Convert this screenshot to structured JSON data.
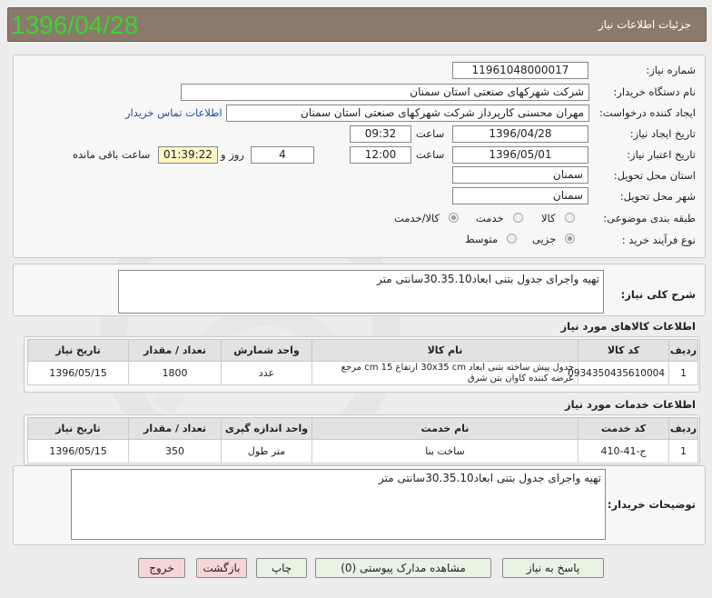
{
  "header": {
    "title": "جزئیات اطلاعات نیاز",
    "big_date": "1396/04/28"
  },
  "form": {
    "need_number_label": "شماره نیاز:",
    "need_number": "11961048000017",
    "buyer_label": "نام دستگاه خریدار:",
    "buyer": "شرکت شهرکهای صنعتی استان سمنان",
    "creator_label": "ایجاد کننده درخواست:",
    "creator": "مهران محسنی کارپرداز شرکت شهرکهای صنعتی استان سمنان",
    "contact_link": "اطلاعات تماس خریدار",
    "created_label": "تاریخ ایجاد نیاز:",
    "created_date": "1396/04/28",
    "time_label": "ساعت",
    "created_time": "09:32",
    "valid_label": "تاریخ اعتبار نیاز:",
    "valid_date": "1396/05/01",
    "valid_time": "12:00",
    "days": "4",
    "days_label": "روز و",
    "remaining": "01:39:22",
    "remaining_label": "ساعت باقی مانده",
    "province_label": "استان محل تحویل:",
    "province": "سمنان",
    "city_label": "شهر محل تحویل:",
    "city": "سمنان",
    "category_label": "طبقه بندی موضوعی:",
    "cat_goods": "کالا",
    "cat_service": "خدمت",
    "cat_both": "کالا/خدمت",
    "process_label": "نوع فرآیند خرید :",
    "proc_partial": "جزیی",
    "proc_medium": "متوسط"
  },
  "summary": {
    "label": "شرح کلی نیاز:",
    "text": "تهیه واجرای جدول بتنی ابعاد30.35.10سانتی متر"
  },
  "goods": {
    "section_title": "اطلاعات کالاهای مورد نیاز",
    "headers": [
      "ردیف",
      "کد کالا",
      "نام کالا",
      "واحد شمارش",
      "تعداد / مقدار",
      "تاریخ نیاز"
    ],
    "rows": [
      {
        "row": "1",
        "code": "0934350435610004",
        "name": "جدول پیش ساخته بتنی ابعاد 30x35 cm ارتفاع 15 cm مرجع عرضه کننده کاوان بتن شرق",
        "unit": "عدد",
        "qty": "1800",
        "date": "1396/05/15"
      }
    ]
  },
  "services": {
    "section_title": "اطلاعات خدمات مورد نیاز",
    "headers": [
      "ردیف",
      "کد خدمت",
      "نام خدمت",
      "واحد اندازه گیری",
      "تعداد / مقدار",
      "تاریخ نیاز"
    ],
    "rows": [
      {
        "row": "1",
        "code": "ج-41-410",
        "name": "ساخت بنا",
        "unit": "متر طول",
        "qty": "350",
        "date": "1396/05/15"
      }
    ]
  },
  "buyer_notes": {
    "label": "توضیحات خریدار:",
    "text": "تهیه واجرای جدول بتنی ابعاد30.35.10سانتی متر"
  },
  "buttons": {
    "reply": "پاسخ به نیاز",
    "docs": "مشاهده مدارک پیوستی (0)",
    "print": "چاپ",
    "back": "بازگشت",
    "exit": "خروج"
  },
  "colors": {
    "title_bar": "#8b7a6b",
    "big_date": "#39d430",
    "link": "#1a4fa8"
  }
}
